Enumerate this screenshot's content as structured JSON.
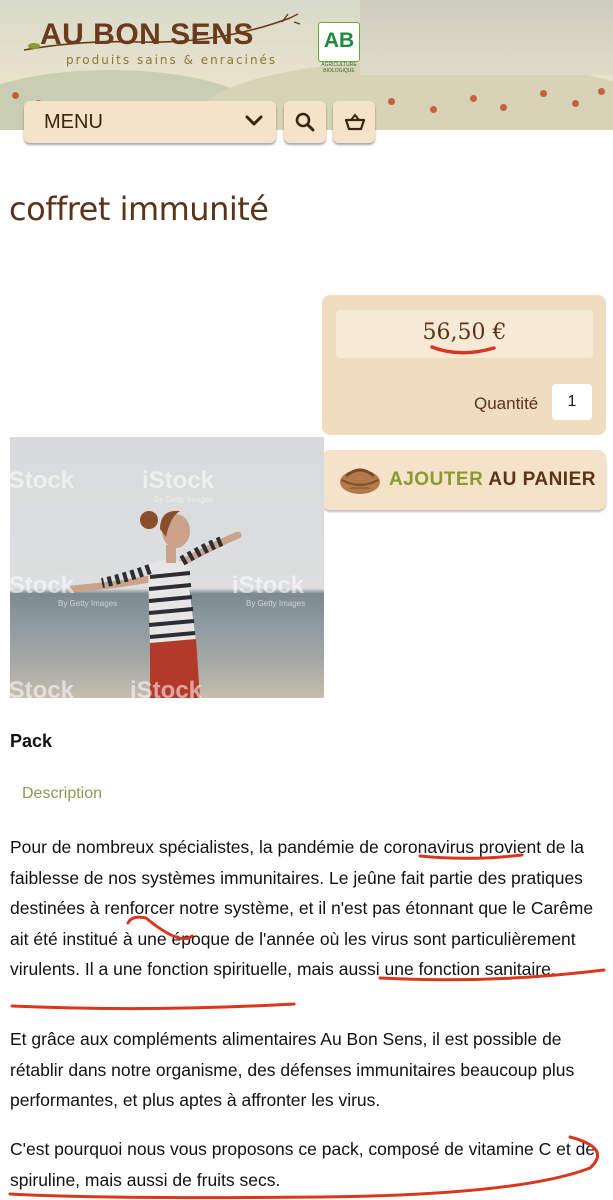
{
  "brand": {
    "name": "AU BON SENS",
    "tagline": "produits sains & enracinés",
    "badge_letters": "AB",
    "badge_caption": "AGRICULTURE BIOLOGIQUE",
    "colors": {
      "brown": "#5a3318",
      "olive": "#8a9a2e",
      "beige": "#f4e3c9",
      "annotation_red": "#d9371e"
    }
  },
  "nav": {
    "menu_label": "MENU",
    "menu_icon": "chevron-down-icon",
    "search_icon": "search-icon",
    "cart_icon": "basket-icon"
  },
  "product": {
    "title": "coffret immunité",
    "price": "56,50",
    "currency": "€",
    "quantity_label": "Quantité",
    "quantity_value": "1",
    "add_to_cart_word1": "AJOUTER",
    "add_to_cart_word2": "AU PANIER",
    "add_to_cart_icon": "basket-icon",
    "image_watermark": "iStock",
    "image_watermark_sub": "By Getty Images",
    "category": "Pack"
  },
  "tabs": {
    "description": "Description"
  },
  "description": {
    "p1": {
      "s1": "Pour de nombreux spécialistes, la pandémie de ",
      "h1": "coronavirus",
      "s2": " provient de la faiblesse de nos systèmes immunitaires. Le jeûne fait partie des pratiques destinées à renforcer notre système, et il n'est pas étonnant que ",
      "h2": "le Carême",
      "s3": " ait été institué à une époque de l'année où les virus sont particulièrement virulents. Il ",
      "h3": "a une fonction spirituelle, mais aussi une fonction sanitaire",
      "s4": "."
    },
    "p2": "Et grâce aux compléments alimentaires Au Bon Sens, il est possible de rétablir dans notre organisme, des défenses immunitaires beaucoup plus performantes, et plus aptes à affronter les virus.",
    "p3": "C'est pourquoi nous vous proposons ce pack, composé de vitamine C et de spiruline, mais aussi de fruits secs."
  }
}
